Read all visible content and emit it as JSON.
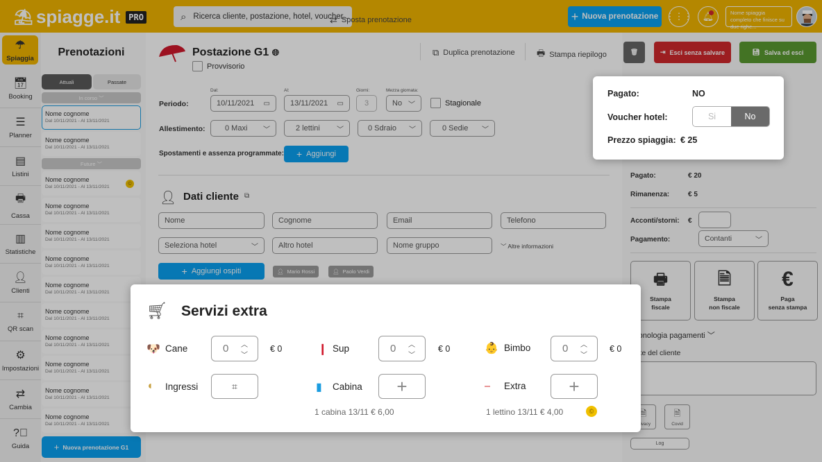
{
  "topbar": {
    "brand": "spiagge.it",
    "pro_badge": "PRO",
    "search_placeholder": "Ricerca cliente, postazione, hotel, voucher...",
    "new_booking_label": "Nuova prenotazione",
    "beach_name": "Nome spiaggia completo che finisce su due righe...",
    "brand_color": "#f0b400",
    "accent_color": "#0aa0f0"
  },
  "nav": {
    "items": [
      {
        "label": "Spiaggia",
        "icon": "umbrella-icon",
        "active": true
      },
      {
        "label": "Booking",
        "icon": "calendar-icon"
      },
      {
        "label": "Planner",
        "icon": "planner-icon"
      },
      {
        "label": "Listini",
        "icon": "list-icon"
      },
      {
        "label": "Cassa",
        "icon": "cash-register-icon"
      },
      {
        "label": "Statistiche",
        "icon": "stats-icon"
      },
      {
        "label": "Clienti",
        "icon": "user-icon"
      },
      {
        "label": "QR scan",
        "icon": "qr-icon"
      },
      {
        "label": "Impostazioni",
        "icon": "gear-icon"
      },
      {
        "label": "Cambia",
        "icon": "swap-icon"
      },
      {
        "label": "Guida",
        "icon": "help-icon"
      }
    ]
  },
  "bookings": {
    "title": "Prenotazioni",
    "tab_current": "Attuali",
    "tab_past": "Passate",
    "group_ongoing": "In corso",
    "group_future": "Future",
    "item_name": "Nome cognome",
    "item_dates": "Dal 10/11/2021 - Al 13/11/2021",
    "new_button": "Nuova prenotazione G1"
  },
  "booking": {
    "title": "Postazione G1",
    "provisional_label": "Provvisorio",
    "actions": {
      "move": "Sposta prenotazione",
      "duplicate": "Duplica prenotazione",
      "print": "Stampa riepilogo"
    },
    "period_label": "Periodo:",
    "from_label": "Dal:",
    "from_value": "10/11/2021",
    "to_label": "Al:",
    "to_value": "13/11/2021",
    "days_label": "Giorni:",
    "days_value": "3",
    "halfday_label": "Mezza giornata:",
    "halfday_value": "No",
    "seasonal_label": "Stagionale",
    "setup_label": "Allestimento:",
    "setup": [
      "0 Maxi",
      "2 lettini",
      "0 Sdraio",
      "0 Sedie"
    ],
    "moves_label": "Spostamenti e assenza programmate:",
    "add_label": "Aggiungi"
  },
  "client": {
    "title": "Dati cliente",
    "first_name_placeholder": "Nome",
    "last_name_placeholder": "Cognome",
    "email_placeholder": "Email",
    "phone_placeholder": "Telefono",
    "hotel_select": "Seleziona hotel",
    "other_hotel_placeholder": "Altro hotel",
    "group_placeholder": "Nome gruppo",
    "more_info": "Altre informazioni",
    "add_guests": "Aggiungi ospiti",
    "guests": [
      "Mario Rossi",
      "Paolo Verdi"
    ]
  },
  "right": {
    "delete_icon": "trash-icon",
    "exit_no_save": "Esci senza salvare",
    "save_exit": "Salva ed esci",
    "paid_label": "Pagato:",
    "paid_value": "€  20",
    "remaining_label": "Rimanenza:",
    "remaining_value": "€  5",
    "deposits_label": "Acconti/storni:",
    "deposits_currency": "€",
    "payment_label": "Pagamento:",
    "payment_value": "Contanti",
    "print_fiscal": [
      "Stampa",
      "fiscale"
    ],
    "print_nonfiscal": [
      "Stampa",
      "non fiscale"
    ],
    "pay_noprint": [
      "Paga",
      "senza stampa"
    ],
    "history": "Cronologia pagamenti",
    "notes_label": "Note del cliente",
    "privacy": "Privacy",
    "covid": "Covid",
    "log": "Log",
    "red": "#d0282c",
    "green": "#5a9a30"
  },
  "payment_popup": {
    "paid_label": "Pagato:",
    "paid_value": "NO",
    "voucher_label": "Voucher hotel:",
    "voucher_yes": "Si",
    "voucher_no": "No",
    "voucher_selected": "No",
    "price_label": "Prezzo spiaggia:",
    "price_value": "€  25"
  },
  "extras": {
    "title": "Servizi extra",
    "items": [
      {
        "label": "Cane",
        "qty": "0",
        "price": "€ 0"
      },
      {
        "label": "Sup",
        "qty": "0",
        "price": "€ 0"
      },
      {
        "label": "Bimbo",
        "qty": "0",
        "price": "€ 0"
      },
      {
        "label": "Ingressi"
      },
      {
        "label": "Cabina",
        "note": "1 cabina 13/11 € 6,00"
      },
      {
        "label": "Extra",
        "note": "1 lettino 13/11 € 4,00"
      }
    ]
  }
}
